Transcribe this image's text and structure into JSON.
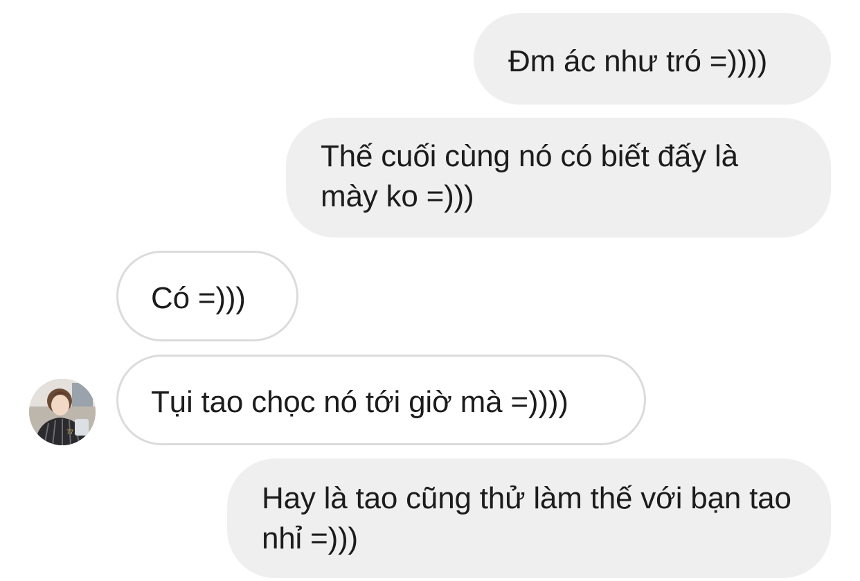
{
  "messages": [
    {
      "id": "msg1",
      "direction": "outgoing",
      "text": "Đm ác như tró =))))"
    },
    {
      "id": "msg2",
      "direction": "outgoing",
      "text": "Thế cuối cùng nó có biết đấy là mày ko =)))"
    },
    {
      "id": "msg3",
      "direction": "incoming",
      "text": "Có =)))"
    },
    {
      "id": "msg4",
      "direction": "incoming",
      "text": "Tụi tao chọc nó tới giờ mà =))))"
    },
    {
      "id": "msg5",
      "direction": "outgoing",
      "text": "Hay là tao cũng thử làm thế với bạn tao nhỉ =)))"
    }
  ],
  "colors": {
    "outgoing_bubble": "#efefef",
    "incoming_border": "#dbdbdb",
    "text": "#1c1c1c"
  },
  "avatar_icon": "user-avatar-photo"
}
